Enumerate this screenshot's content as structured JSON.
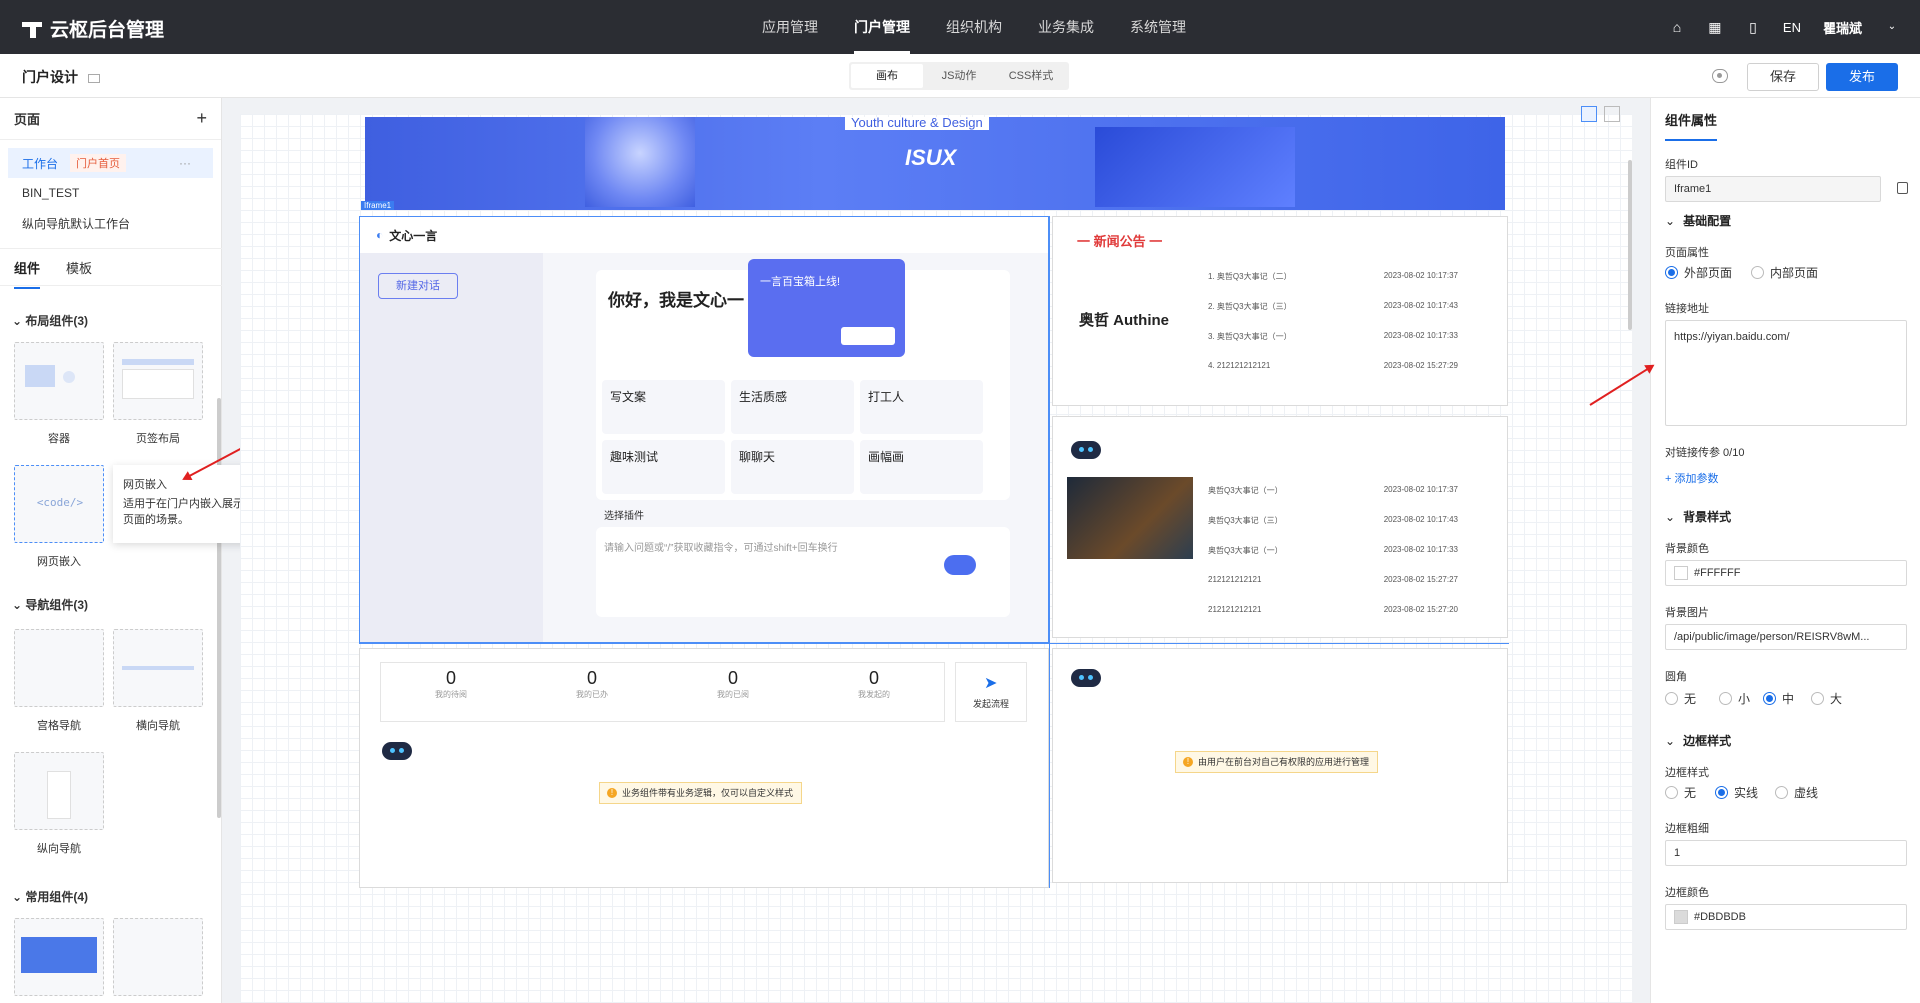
{
  "topbar": {
    "app_title": "云枢后台管理",
    "nav": [
      "应用管理",
      "门户管理",
      "组织机构",
      "业务集成",
      "系统管理"
    ],
    "lang": "EN",
    "user": "瞿瑞斌"
  },
  "toolbar": {
    "page_title": "门户设计",
    "tabs": [
      "画布",
      "JS动作",
      "CSS样式"
    ],
    "save": "保存",
    "publish": "发布"
  },
  "left": {
    "pages_header": "页面",
    "pages": [
      {
        "name": "工作台",
        "tag": "门户首页"
      },
      {
        "name": "BIN_TEST"
      },
      {
        "name": "纵向导航默认工作台"
      }
    ],
    "tabs": [
      "组件",
      "模板"
    ],
    "groups": [
      {
        "title": "布局组件(3)",
        "items": [
          "容器",
          "页签布局"
        ]
      },
      {
        "title": "网页嵌入"
      },
      {
        "title": "导航组件(3)",
        "items": [
          "宫格导航",
          "横向导航",
          "纵向导航"
        ]
      },
      {
        "title": "常用组件(4)"
      }
    ],
    "iframe_item": "网页嵌入",
    "iframe_code": "<code/>",
    "tooltip_title": "网页嵌入",
    "tooltip_body": "适用于在门户内嵌入展示指定链接页面的场景。"
  },
  "canvas": {
    "banner_text": "ISUX",
    "banner_sub": "Youth culture & Design",
    "frame_label": "Iframe1",
    "iframe": {
      "brand": "文心一言",
      "new_chat": "新建对话",
      "greeting": "你好，我是文心一",
      "popup": "一言百宝箱上线!",
      "cards": [
        "写文案",
        "生活质感",
        "打工人",
        "趣味测试",
        "聊聊天",
        "画幅画"
      ],
      "plugin": "选择插件",
      "placeholder": "请输入问题或“/”获取收藏指令，可通过shift+回车换行"
    },
    "news": {
      "title": "一 新闻公告 一",
      "brand": "奥哲 Authine",
      "rows": [
        {
          "t": "1.  奥哲Q3大事记（二）",
          "d": "2023-08-02 10:17:37"
        },
        {
          "t": "2.  奥哲Q3大事记（三）",
          "d": "2023-08-02 10:17:43"
        },
        {
          "t": "3.  奥哲Q3大事记（一）",
          "d": "2023-08-02 10:17:33"
        },
        {
          "t": "4.  212121212121",
          "d": "2023-08-02 15:27:29"
        }
      ]
    },
    "list2": [
      {
        "t": "奥哲Q3大事记（一）",
        "d": "2023-08-02 10:17:37"
      },
      {
        "t": "奥哲Q3大事记（三）",
        "d": "2023-08-02 10:17:43"
      },
      {
        "t": "奥哲Q3大事记（一）",
        "d": "2023-08-02 10:17:33"
      },
      {
        "t": "212121212121",
        "d": "2023-08-02 15:27:27"
      },
      {
        "t": "212121212121",
        "d": "2023-08-02 15:27:20"
      }
    ],
    "stats": [
      {
        "n": "0",
        "l": "我的待阅"
      },
      {
        "n": "0",
        "l": "我的已办"
      },
      {
        "n": "0",
        "l": "我的已阅"
      },
      {
        "n": "0",
        "l": "我发起的"
      }
    ],
    "start_flow": "发起流程",
    "warn1": "业务组件带有业务逻辑，仅可以自定义样式",
    "warn2": "由用户在前台对自己有权限的应用进行管理"
  },
  "right": {
    "title": "组件属性",
    "id_label": "组件ID",
    "id_value": "Iframe1",
    "basic": "基础配置",
    "page_attr": "页面属性",
    "page_opts": [
      "外部页面",
      "内部页面"
    ],
    "url_label": "链接地址",
    "url": "https://yiyan.baidu.com/",
    "param_label": "对链接传参 0/10",
    "add_param": "+ 添加参数",
    "bg_section": "背景样式",
    "bg_color_label": "背景颜色",
    "bg_color": "#FFFFFF",
    "bg_img_label": "背景图片",
    "bg_img": "/api/public/image/person/REISRV8wM...",
    "radius_label": "圆角",
    "radius_opts": [
      "无",
      "小",
      "中",
      "大"
    ],
    "border_section": "边框样式",
    "border_style_label": "边框样式",
    "border_opts": [
      "无",
      "实线",
      "虚线"
    ],
    "border_width_label": "边框粗细",
    "border_width": "1",
    "border_color_label": "边框颜色",
    "border_color": "#DBDBDB"
  }
}
